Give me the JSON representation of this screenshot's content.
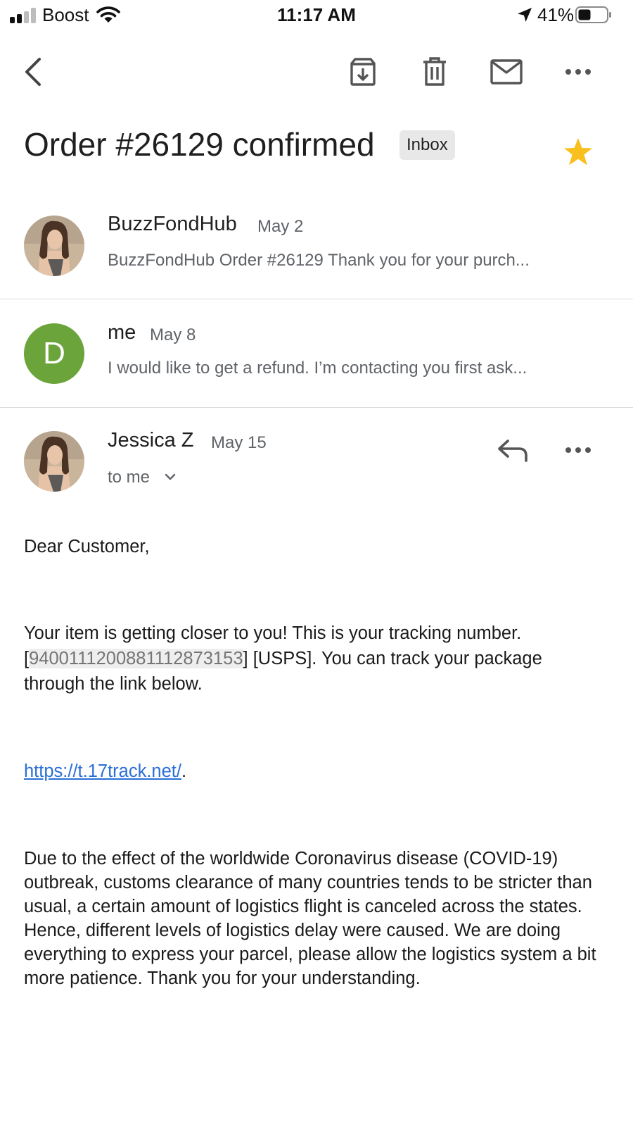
{
  "status_bar": {
    "carrier": "Boost",
    "time": "11:17 AM",
    "battery": "41%"
  },
  "toolbar": {
    "icons": [
      "back-icon",
      "archive-icon",
      "delete-icon",
      "mail-icon",
      "more-icon"
    ]
  },
  "thread": {
    "subject": "Order #26129 confirmed",
    "label": "Inbox",
    "starred": true
  },
  "messages": [
    {
      "sender": "BuzzFondHub",
      "date": "May 2",
      "snippet": "BuzzFondHub Order #26129 Thank you for your purch..."
    },
    {
      "avatar_letter": "D",
      "sender": "me",
      "date": "May 8",
      "snippet": "I would like to get a refund. I’m contacting you first ask..."
    },
    {
      "sender": "Jessica Z",
      "date": "May 15",
      "recipient": "to me"
    }
  ],
  "email_body": {
    "greeting": "Dear Customer,",
    "para1_before": "Your item is getting closer to you! This is your tracking number. [",
    "tracking_number": "9400111200881112873153",
    "para1_after": "] [USPS]. You can track your package through the link below.",
    "link": "https://t.17track.net/",
    "link_suffix": ".",
    "para2": "Due to the effect of the worldwide Coronavirus disease (COVID-19) outbreak, customs clearance of many countries tends to be stricter than usual, a certain amount of logistics flight is canceled across the states. Hence, different levels of logistics delay were caused. We are doing everything to express your parcel, please allow the logistics system a bit more patience. Thank you for your understanding."
  },
  "colors": {
    "star": "#f9bf1e",
    "avatar_me": "#6ba43a",
    "link": "#2a6fd6",
    "divider": "#dadce0"
  }
}
